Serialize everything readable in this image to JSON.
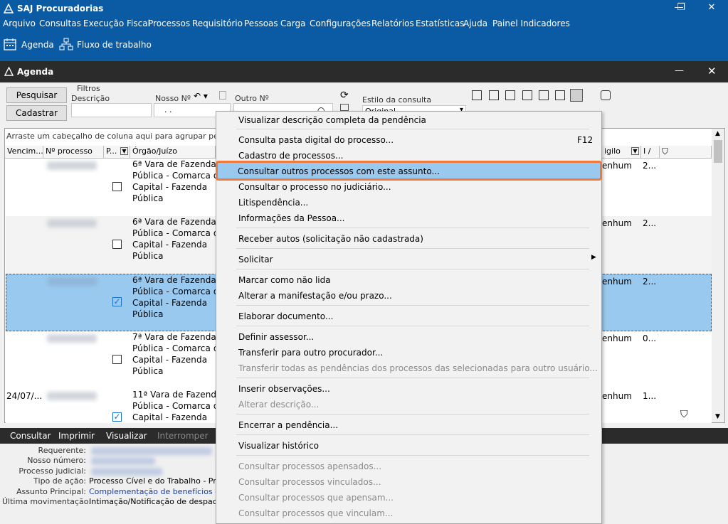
{
  "app": {
    "title": "SAJ Procuradorias"
  },
  "menu": [
    "Arquivo",
    "Consultas",
    "Execução Fiscal",
    "Processos",
    "Requisitório",
    "Pessoas",
    "Carga",
    "Configurações",
    "Relatórios",
    "Estatísticas",
    "Ajuda",
    "Painel Indicadores"
  ],
  "toolbar": {
    "agenda": "Agenda",
    "fluxo": "Fluxo de trabalho"
  },
  "child": {
    "title": "Agenda"
  },
  "filters": {
    "pesquisar": "Pesquisar",
    "cadastrar": "Cadastrar",
    "group_label": "Filtros",
    "descricao": "Descrição",
    "nosso_numero": "Nosso Nº",
    "outro_numero": "Outro Nº",
    "nosso_value": ". .",
    "estilo": "Estilo da consulta",
    "estilo_value": "Original"
  },
  "grid": {
    "group_hint": "Arraste um cabeçalho de coluna aqui para agrupar pela coluna",
    "columns": {
      "venc": "Vencim...",
      "processo": "Nº processo",
      "p": "P...",
      "orgao": "Órgão/Juízo",
      "sigilo": "igilo",
      "i": "I /"
    },
    "rows": [
      {
        "venc": "",
        "orgao": [
          "6ª Vara de Fazenda",
          "Pública - Comarca da",
          "Capital - Fazenda",
          "Pública"
        ],
        "checked": false,
        "sigilo": "enhum",
        "i": "2..."
      },
      {
        "venc": "",
        "orgao": [
          "6ª Vara de Fazenda",
          "Pública - Comarca da",
          "Capital - Fazenda",
          "Pública"
        ],
        "checked": false,
        "sigilo": "enhum",
        "i": "2..."
      },
      {
        "venc": "",
        "orgao": [
          "6ª Vara de Fazenda",
          "Pública - Comarca da",
          "Capital - Fazenda",
          "Pública"
        ],
        "checked": true,
        "sigilo": "enhum",
        "i": "2..."
      },
      {
        "venc": "",
        "orgao": [
          "7ª Vara de Fazenda",
          "Pública - Comarca da",
          "Capital - Fazenda",
          "Pública"
        ],
        "checked": false,
        "sigilo": "enhum",
        "i": "0..."
      },
      {
        "venc": "24/07/...",
        "orgao": [
          "11ª Vara de Fazenda",
          "Pública - Comarca da",
          "Capital - Fazenda",
          ""
        ],
        "checked": true,
        "sigilo": "enhum",
        "i": "1..."
      }
    ]
  },
  "bottom": {
    "consultar": "Consultar",
    "imprimir": "Imprimir",
    "visualizar": "Visualizar",
    "interromper": "Interromper"
  },
  "details": {
    "labels": [
      "Requerente:",
      "Nosso número:",
      "Processo judicial:",
      "Tipo de ação:",
      "Assunto Principal:",
      "Última movimentação:"
    ],
    "tipo": "Processo Cível e do Trabalho - Proc",
    "assunto": "Complementação de benefícios - P",
    "movimentacao": "Intimação/Notificação de despacho"
  },
  "context_menu": {
    "items": [
      {
        "label": "Visualizar descrição completa da pendência",
        "enabled": true
      },
      {
        "label": "Consulta pasta digital do processo...",
        "shortcut": "F12",
        "enabled": true
      },
      {
        "label": "Cadastro de processos...",
        "enabled": true
      },
      {
        "label": "Consultar outros processos com este assunto...",
        "enabled": true,
        "highlighted": true
      },
      {
        "label": "Consultar o processo no judiciário...",
        "enabled": true
      },
      {
        "label": "Litispendência...",
        "enabled": true
      },
      {
        "label": "Informações da Pessoa...",
        "enabled": true
      },
      {
        "label": "Receber autos (solicitação não cadastrada)",
        "enabled": true
      },
      {
        "label": "Solicitar",
        "enabled": true,
        "submenu": true
      },
      {
        "label": "Marcar como não lida",
        "enabled": true
      },
      {
        "label": "Alterar a manifestação e/ou prazo...",
        "enabled": true
      },
      {
        "label": "Elaborar documento...",
        "enabled": true
      },
      {
        "label": "Definir assessor...",
        "enabled": true
      },
      {
        "label": "Transferir para outro procurador...",
        "enabled": true
      },
      {
        "label": "Transferir todas as pendências dos processos das selecionadas para outro usuário...",
        "enabled": false
      },
      {
        "label": "Inserir observações...",
        "enabled": true
      },
      {
        "label": "Alterar descrição...",
        "enabled": false
      },
      {
        "label": "Encerrar a pendência...",
        "enabled": true
      },
      {
        "label": "Visualizar histórico",
        "enabled": true
      },
      {
        "label": "Consultar processos apensados...",
        "enabled": false
      },
      {
        "label": "Consultar processos vinculados...",
        "enabled": false
      },
      {
        "label": "Consultar processos que apensam...",
        "enabled": false
      },
      {
        "label": "Consultar processos que vinculam...",
        "enabled": false
      }
    ]
  },
  "colors": {
    "title_bar": "#0a5ba3",
    "dark_bar": "#2b2b2b",
    "selection": "#99c9ef",
    "highlight_border": "#f07a3e"
  }
}
